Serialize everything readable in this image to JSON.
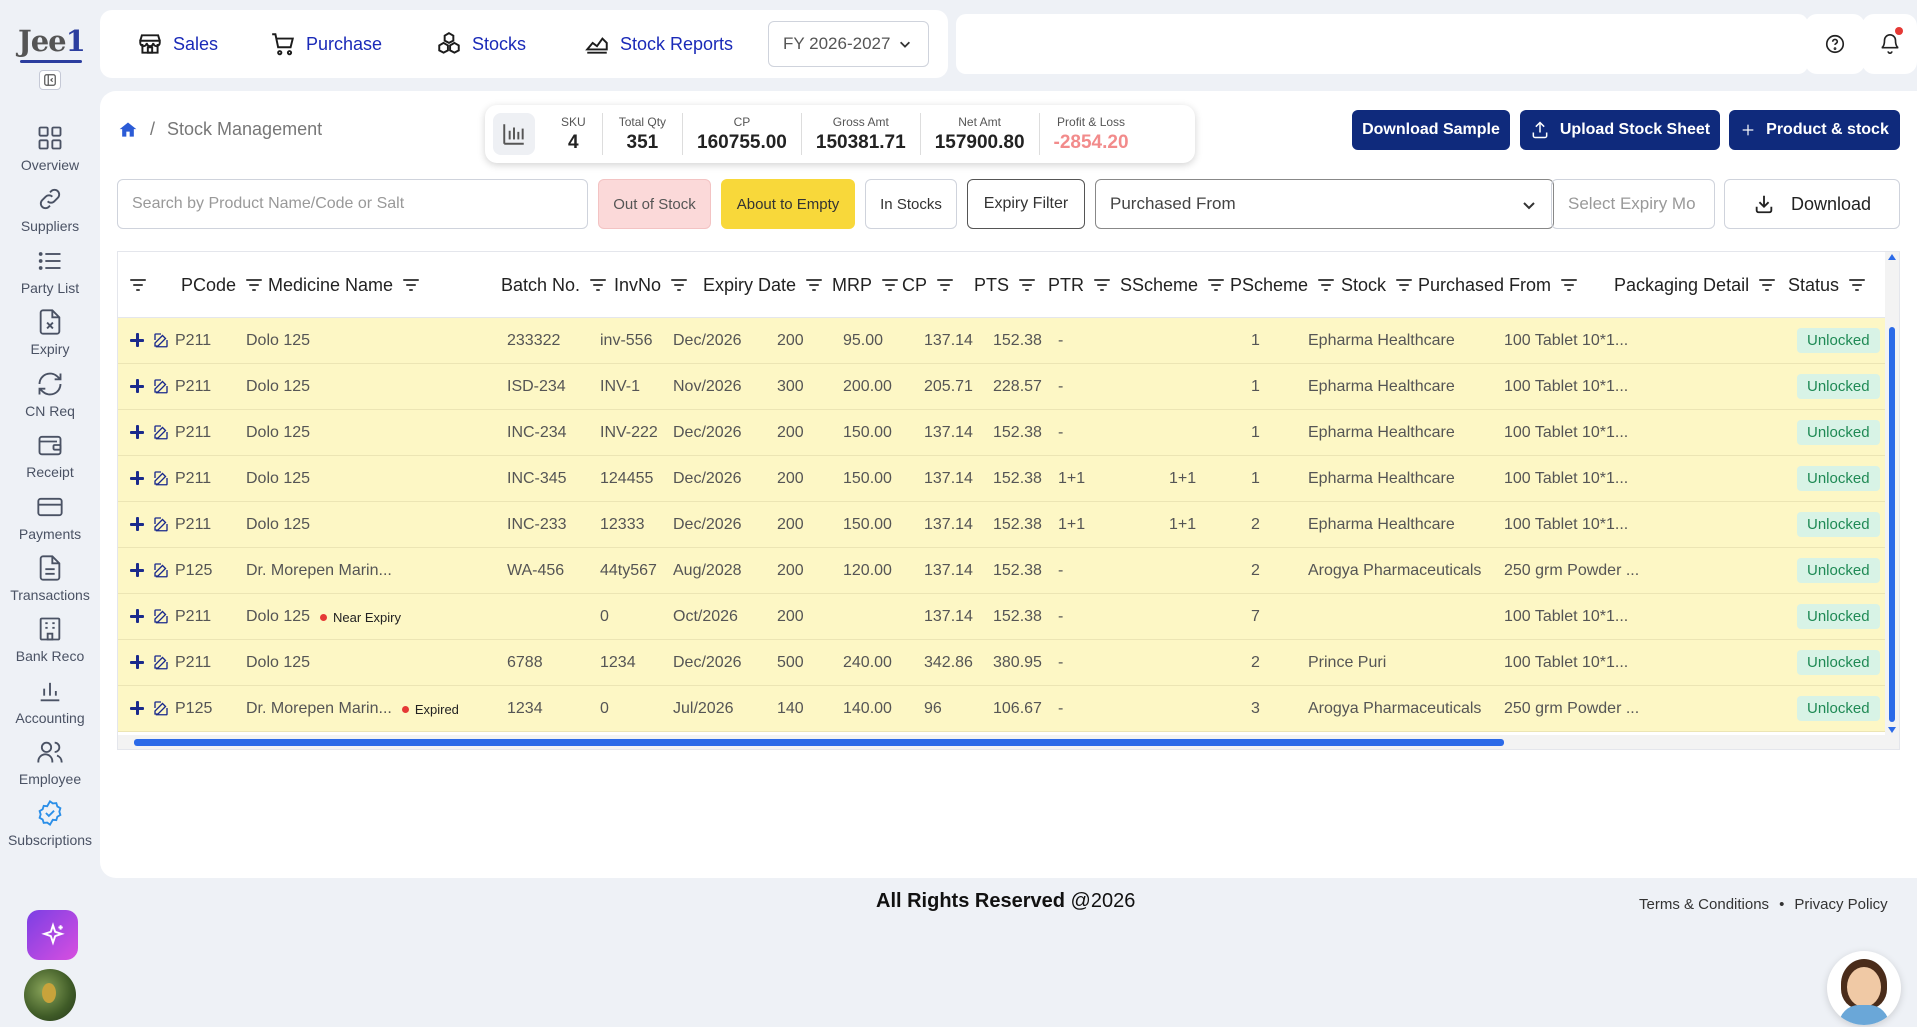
{
  "app": {
    "logo_text": "Jee",
    "logo_num": "1"
  },
  "sidebar": {
    "items": [
      {
        "label": "Overview",
        "icon": "grid-icon"
      },
      {
        "label": "Suppliers",
        "icon": "link-icon"
      },
      {
        "label": "Party List",
        "icon": "list-icon"
      },
      {
        "label": "Expiry",
        "icon": "file-x-icon"
      },
      {
        "label": "CN Req",
        "icon": "refresh-icon"
      },
      {
        "label": "Receipt",
        "icon": "wallet-icon"
      },
      {
        "label": "Payments",
        "icon": "card-icon"
      },
      {
        "label": "Transactions",
        "icon": "document-icon"
      },
      {
        "label": "Bank Reco",
        "icon": "building-icon"
      },
      {
        "label": "Accounting",
        "icon": "bar-chart-icon"
      },
      {
        "label": "Employee",
        "icon": "users-icon"
      },
      {
        "label": "Subscriptions",
        "icon": "badge-check-icon"
      }
    ]
  },
  "topnav": {
    "sales": "Sales",
    "purchase": "Purchase",
    "stocks": "Stocks",
    "stock_reports": "Stock Reports",
    "fy": "FY 2026-2027"
  },
  "breadcrumb": {
    "page": "Stock Management"
  },
  "stats": [
    {
      "label": "SKU",
      "value": "4"
    },
    {
      "label": "Total Qty",
      "value": "351"
    },
    {
      "label": "CP",
      "value": "160755.00"
    },
    {
      "label": "Gross Amt",
      "value": "150381.71"
    },
    {
      "label": "Net Amt",
      "value": "157900.80"
    },
    {
      "label": "Profit & Loss",
      "value": "-2854.20"
    }
  ],
  "actions": {
    "download_sample": "Download Sample",
    "upload_sheet": "Upload Stock Sheet",
    "product_stock": "Product & stock"
  },
  "filters": {
    "search_placeholder": "Search by Product Name/Code or Salt",
    "out_of_stock": "Out of Stock",
    "about_to_empty": "About to Empty",
    "in_stocks": "In Stocks",
    "expiry_filter": "Expiry Filter",
    "purchased_from": "Purchased From",
    "expiry_month_placeholder": "Select Expiry Mo",
    "download": "Download"
  },
  "table": {
    "columns": [
      "PCode",
      "Medicine Name",
      "Batch No.",
      "InvNo",
      "Expiry Date",
      "MRP",
      "CP",
      "PTS",
      "PTR",
      "SScheme",
      "PScheme",
      "Stock",
      "Purchased From",
      "Packaging Detail",
      "Status"
    ],
    "rows": [
      {
        "pcode": "P211",
        "name": "Dolo 125",
        "tag": "",
        "batch": "233322",
        "inv": "inv-556",
        "expiry": "Dec/2026",
        "mrp": "200",
        "cp": "95.00",
        "pts": "137.14",
        "ptr": "152.38",
        "ss": "-",
        "ps": "",
        "stock": "1",
        "from": "Epharma Healthcare",
        "pack": "100 Tablet 10*1...",
        "status": "Unlocked"
      },
      {
        "pcode": "P211",
        "name": "Dolo 125",
        "tag": "",
        "batch": "ISD-234",
        "inv": "INV-1",
        "expiry": "Nov/2026",
        "mrp": "300",
        "cp": "200.00",
        "pts": "205.71",
        "ptr": "228.57",
        "ss": "-",
        "ps": "",
        "stock": "1",
        "from": "Epharma Healthcare",
        "pack": "100 Tablet 10*1...",
        "status": "Unlocked"
      },
      {
        "pcode": "P211",
        "name": "Dolo 125",
        "tag": "",
        "batch": "INC-234",
        "inv": "INV-222",
        "expiry": "Dec/2026",
        "mrp": "200",
        "cp": "150.00",
        "pts": "137.14",
        "ptr": "152.38",
        "ss": "-",
        "ps": "",
        "stock": "1",
        "from": "Epharma Healthcare",
        "pack": "100 Tablet 10*1...",
        "status": "Unlocked"
      },
      {
        "pcode": "P211",
        "name": "Dolo 125",
        "tag": "",
        "batch": "INC-345",
        "inv": "124455",
        "expiry": "Dec/2026",
        "mrp": "200",
        "cp": "150.00",
        "pts": "137.14",
        "ptr": "152.38",
        "ss": "1+1",
        "ps": "1+1",
        "stock": "1",
        "from": "Epharma Healthcare",
        "pack": "100 Tablet 10*1...",
        "status": "Unlocked"
      },
      {
        "pcode": "P211",
        "name": "Dolo 125",
        "tag": "",
        "batch": "INC-233",
        "inv": "12333",
        "expiry": "Dec/2026",
        "mrp": "200",
        "cp": "150.00",
        "pts": "137.14",
        "ptr": "152.38",
        "ss": "1+1",
        "ps": "1+1",
        "stock": "2",
        "from": "Epharma Healthcare",
        "pack": "100 Tablet 10*1...",
        "status": "Unlocked"
      },
      {
        "pcode": "P125",
        "name": "Dr. Morepen Marin...",
        "tag": "",
        "batch": "WA-456",
        "inv": "44ty567",
        "expiry": "Aug/2028",
        "mrp": "200",
        "cp": "120.00",
        "pts": "137.14",
        "ptr": "152.38",
        "ss": "-",
        "ps": "",
        "stock": "2",
        "from": "Arogya Pharmaceuticals",
        "pack": "250 grm Powder ...",
        "status": "Unlocked"
      },
      {
        "pcode": "P211",
        "name": "Dolo 125",
        "tag": "Near Expiry",
        "batch": "",
        "inv": "0",
        "expiry": "Oct/2026",
        "mrp": "200",
        "cp": "",
        "pts": "137.14",
        "ptr": "152.38",
        "ss": "-",
        "ps": "",
        "stock": "7",
        "from": "",
        "pack": "100 Tablet 10*1...",
        "status": "Unlocked"
      },
      {
        "pcode": "P211",
        "name": "Dolo 125",
        "tag": "",
        "batch": "6788",
        "inv": "1234",
        "expiry": "Dec/2026",
        "mrp": "500",
        "cp": "240.00",
        "pts": "342.86",
        "ptr": "380.95",
        "ss": "-",
        "ps": "",
        "stock": "2",
        "from": "Prince Puri",
        "pack": "100 Tablet 10*1...",
        "status": "Unlocked"
      },
      {
        "pcode": "P125",
        "name": "Dr. Morepen Marin...",
        "tag": "Expired",
        "batch": "1234",
        "inv": "0",
        "expiry": "Jul/2026",
        "mrp": "140",
        "cp": "140.00",
        "pts": "96",
        "ptr": "106.67",
        "ss": "-",
        "ps": "",
        "stock": "3",
        "from": "Arogya Pharmaceuticals",
        "pack": "250 grm Powder ...",
        "status": "Unlocked"
      }
    ]
  },
  "footer": {
    "rights": "All Rights Reserved",
    "year": "@2026",
    "terms": "Terms & Conditions",
    "sep": "•",
    "privacy": "Privacy Policy"
  },
  "colors": {
    "accent": "#0f2a7c",
    "nav_link": "#1a2ab8",
    "row_bg": "#fdf7c5",
    "status_bg": "#d8f3e6",
    "status_text": "#1f8a55",
    "loss": "#f28b8b"
  }
}
